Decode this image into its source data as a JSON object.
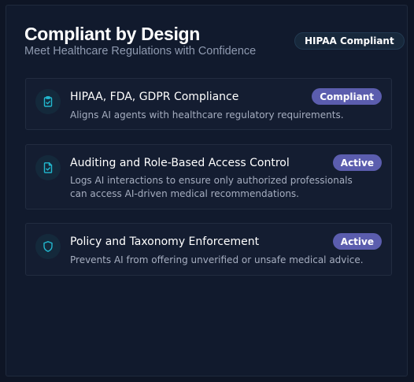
{
  "header": {
    "title": "Compliant by Design",
    "subtitle": "Meet Healthcare Regulations with Confidence",
    "badge": "HIPAA Compliant"
  },
  "features": [
    {
      "title": "HIPAA, FDA, GDPR Compliance",
      "description": "Aligns AI agents with healthcare regulatory requirements.",
      "status": "Compliant",
      "icon": "clipboard-check-icon"
    },
    {
      "title": "Auditing and Role-Based Access Control",
      "description": "Logs AI interactions to ensure only authorized professionals can access AI-driven medical recommendations.",
      "status": "Active",
      "icon": "file-check-icon"
    },
    {
      "title": "Policy and Taxonomy Enforcement",
      "description": "Prevents AI from offering unverified or unsafe medical advice.",
      "status": "Active",
      "icon": "shield-icon"
    }
  ],
  "colors": {
    "background": "#0e1525",
    "card": "#141d31",
    "accent": "#22b8cf",
    "status_badge": "#5b5dae"
  }
}
